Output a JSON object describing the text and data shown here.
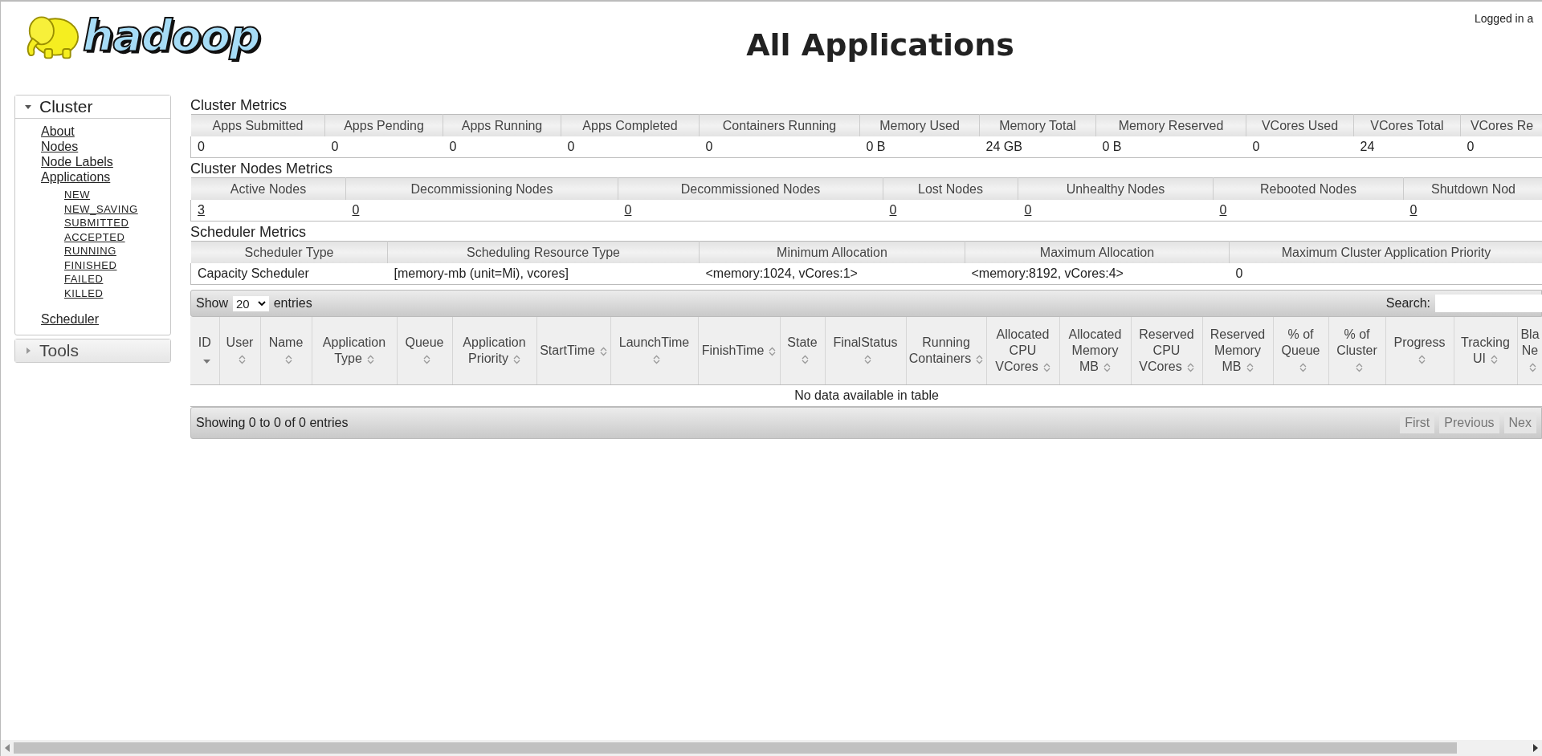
{
  "header": {
    "logo_text": "hadoop",
    "title": "All Applications",
    "login": "Logged in a"
  },
  "sidebar": [
    {
      "label": "Cluster",
      "expanded": true,
      "items": [
        {
          "label": "About"
        },
        {
          "label": "Nodes"
        },
        {
          "label": "Node Labels"
        },
        {
          "label": "Applications",
          "children": [
            {
              "label": "NEW"
            },
            {
              "label": "NEW_SAVING"
            },
            {
              "label": "SUBMITTED"
            },
            {
              "label": "ACCEPTED"
            },
            {
              "label": "RUNNING"
            },
            {
              "label": "FINISHED"
            },
            {
              "label": "FAILED"
            },
            {
              "label": "KILLED"
            }
          ]
        },
        {
          "label": "Scheduler",
          "spaced": true
        }
      ]
    },
    {
      "label": "Tools",
      "expanded": false
    }
  ],
  "metrics": [
    {
      "title": "Cluster Metrics",
      "links": false,
      "columns": [
        "Apps Submitted",
        "Apps Pending",
        "Apps Running",
        "Apps Completed",
        "Containers Running",
        "Memory Used",
        "Memory Total",
        "Memory Reserved",
        "VCores Used",
        "VCores Total",
        "VCores Re"
      ],
      "rows": [
        [
          "0",
          "0",
          "0",
          "0",
          "0",
          "0 B",
          "24 GB",
          "0 B",
          "0",
          "24",
          "0"
        ]
      ]
    },
    {
      "title": "Cluster Nodes Metrics",
      "links": true,
      "columns": [
        "Active Nodes",
        "Decommissioning Nodes",
        "Decommissioned Nodes",
        "Lost Nodes",
        "Unhealthy Nodes",
        "Rebooted Nodes",
        "Shutdown Nod"
      ],
      "rows": [
        [
          "3",
          "0",
          "0",
          "0",
          "0",
          "0",
          "0"
        ]
      ]
    },
    {
      "title": "Scheduler Metrics",
      "links": false,
      "columns": [
        "Scheduler Type",
        "Scheduling Resource Type",
        "Minimum Allocation",
        "Maximum Allocation",
        "Maximum Cluster Application Priority"
      ],
      "rows": [
        [
          "Capacity Scheduler",
          "[memory-mb (unit=Mi), vcores]",
          "<memory:1024, vCores:1>",
          "<memory:8192, vCores:4>",
          "0"
        ]
      ]
    }
  ],
  "apps_table": {
    "length_menu": {
      "prefix": "Show",
      "value": "20",
      "suffix": "entries"
    },
    "search": {
      "label": "Search:"
    },
    "columns": [
      {
        "label": "ID",
        "sorted": true
      },
      {
        "label": "User",
        "sorted": false
      },
      {
        "label": "Name",
        "sorted": false
      },
      {
        "label": "Application Type",
        "sorted": false
      },
      {
        "label": "Queue",
        "sorted": false
      },
      {
        "label": "Application Priority",
        "sorted": false
      },
      {
        "label": "StartTime",
        "sorted": false
      },
      {
        "label": "LaunchTime",
        "sorted": false
      },
      {
        "label": "FinishTime",
        "sorted": false
      },
      {
        "label": "State",
        "sorted": false
      },
      {
        "label": "FinalStatus",
        "sorted": false
      },
      {
        "label": "Running Containers",
        "sorted": false
      },
      {
        "label": "Allocated CPU VCores",
        "sorted": false
      },
      {
        "label": "Allocated Memory MB",
        "sorted": false
      },
      {
        "label": "Reserved CPU VCores",
        "sorted": false
      },
      {
        "label": "Reserved Memory MB",
        "sorted": false
      },
      {
        "label": "% of Queue",
        "sorted": false
      },
      {
        "label": "% of Cluster",
        "sorted": false
      },
      {
        "label": "Progress",
        "sorted": false
      },
      {
        "label": "Tracking UI",
        "sorted": false
      },
      {
        "label": "Bla Ne",
        "sorted": false
      }
    ],
    "empty_message": "No data available in table",
    "info": "Showing 0 to 0 of 0 entries",
    "pagination": [
      {
        "label": "First",
        "disabled": true
      },
      {
        "label": "Previous",
        "disabled": true
      },
      {
        "label": "Nex",
        "disabled": true
      }
    ]
  }
}
